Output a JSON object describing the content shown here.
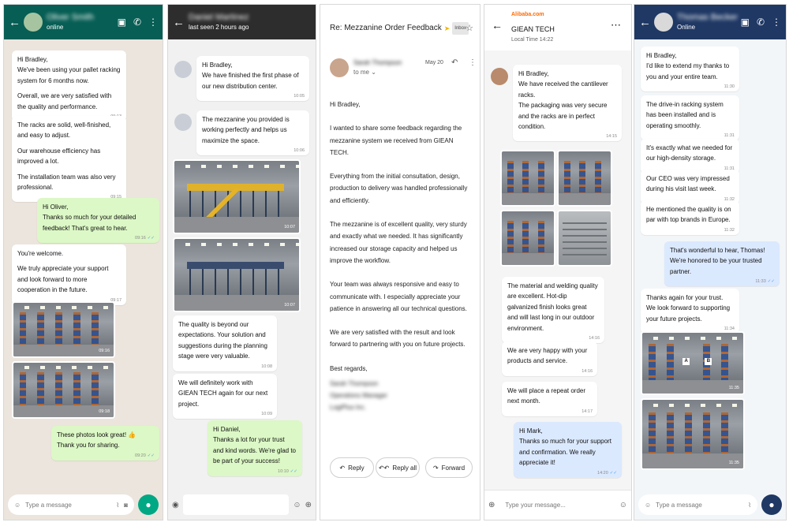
{
  "p1": {
    "header": {
      "name": "Oliver Smith",
      "status": "online"
    },
    "messages": [
      {
        "paras": [
          "Hi Bradley,\nWe've been using your pallet racking system for 6 months now.",
          "Overall, we are very satisfied with the quality and performance."
        ],
        "time": "09:13"
      },
      {
        "paras": [
          "The racks are solid, well-finished, and easy to adjust.",
          "Our warehouse efficiency has improved a lot.",
          "The installation team was also very professional."
        ],
        "time": "09:15"
      },
      {
        "paras": [
          "Hi Oliver,\nThanks so much for your detailed feedback! That's great to hear."
        ],
        "time": "09:16",
        "check": "✓✓"
      },
      {
        "paras": [
          "You're welcome.",
          "We truly appreciate your support and look forward to more cooperation in the future."
        ],
        "time": "09:17"
      },
      {
        "paras": [
          "These photos look great! 👍\nThank you for sharing."
        ],
        "time": "09:20",
        "check": "✓✓"
      }
    ],
    "photos": [
      {
        "time": "09:16"
      },
      {
        "time": "09:18"
      }
    ],
    "input_placeholder": "Type a message"
  },
  "p2": {
    "header": {
      "name": "Daniel Martinez",
      "status": "last seen 2 hours ago"
    },
    "messages": [
      {
        "paras": [
          "Hi Bradley,\nWe have finished the first phase of our new distribution center."
        ],
        "time": "10:05"
      },
      {
        "paras": [
          "The mezzanine you provided is working perfectly and helps us maximize the space."
        ],
        "time": "10:06"
      },
      {
        "paras": [
          "The quality is beyond our expectations. Your solution and suggestions during the planning stage were very valuable."
        ],
        "time": "10:08"
      },
      {
        "paras": [
          "We will definitely work with GIEAN TECH again for our next project."
        ],
        "time": "10:09"
      },
      {
        "paras": [
          "Hi Daniel,\nThanks a lot for your trust and kind words. We're glad to be part of your success!"
        ],
        "time": "10:10",
        "check": "✓✓"
      }
    ],
    "photos": [
      {
        "time": "10:07"
      },
      {
        "time": "10:07"
      }
    ]
  },
  "p3": {
    "subject": "Re: Mezzanine Order Feedback",
    "badge": "Inbox",
    "sender": "Sarah Thompson",
    "date": "May 20",
    "to": "to me",
    "body": [
      "Hi Bradley,",
      "I wanted to share some feedback regarding the mezzanine system we received from GIEAN TECH.",
      "Everything from the initial consultation, design, production to delivery was handled professionally and efficiently.",
      "The mezzanine is of excellent quality, very sturdy and exactly what we needed. It has significantly increased our storage capacity and helped us improve the workflow.",
      "Your team was always responsive and easy to communicate with. I especially appreciate your patience in answering all our technical questions.",
      "We are very satisfied with the result and look forward to partnering with you on future projects.",
      "Best regards,"
    ],
    "signature": [
      "Sarah Thompson",
      "Operations Manager",
      "LogiPlus Inc."
    ],
    "buttons": {
      "reply": "Reply",
      "reply_all": "Reply all",
      "forward": "Forward"
    }
  },
  "p4": {
    "brand": "Alibaba.com",
    "company": "GIEAN TECH",
    "local_time": "Local Time 14:22",
    "messages": [
      {
        "paras": [
          "Hi Bradley,\nWe have received the cantilever racks.\nThe packaging was very secure and the racks are in perfect condition."
        ],
        "time": "14:15"
      },
      {
        "paras": [
          "The material and welding quality are excellent. Hot-dip galvanized finish looks great and will last long in our outdoor environment."
        ],
        "time": "14:16"
      },
      {
        "paras": [
          "We are very happy with your products and service."
        ],
        "time": "14:16"
      },
      {
        "paras": [
          "We will place a repeat order next month."
        ],
        "time": "14:17"
      },
      {
        "paras": [
          "Hi Mark,\nThanks so much for your support and confirmation. We really appreciate it!"
        ],
        "time": "14:20",
        "check": "✓✓"
      }
    ],
    "input_placeholder": "Type your message..."
  },
  "p5": {
    "header": {
      "name": "Thomas Becker",
      "status": "Online"
    },
    "messages": [
      {
        "paras": [
          "Hi Bradley,\nI'd like to extend my thanks to you and your entire team."
        ],
        "time": "11:30"
      },
      {
        "paras": [
          "The drive-in racking system has been installed and is operating smoothly."
        ],
        "time": "11:31"
      },
      {
        "paras": [
          "It's exactly what we needed for our high-density storage."
        ],
        "time": "11:31"
      },
      {
        "paras": [
          "Our CEO was very impressed during his visit last week."
        ],
        "time": "11:32"
      },
      {
        "paras": [
          "He mentioned the quality is on par with top brands in Europe."
        ],
        "time": "11:32"
      },
      {
        "paras": [
          "That's wonderful to hear, Thomas! We're honored to be your trusted partner."
        ],
        "time": "11:33",
        "check": "✓✓"
      },
      {
        "paras": [
          "Thanks again for your trust.\nWe look forward to supporting your future projects."
        ],
        "time": "11:34"
      }
    ],
    "photos": [
      {
        "time": "11:35"
      },
      {
        "time": "11:35"
      }
    ],
    "input_placeholder": "Type a message"
  },
  "colors": {
    "whatsapp_green": "#075e54",
    "mic_green": "#00a884",
    "teams_blue": "#1f3864",
    "alibaba_orange": "#ff6a00",
    "check_blue": "#4fa3e8"
  }
}
